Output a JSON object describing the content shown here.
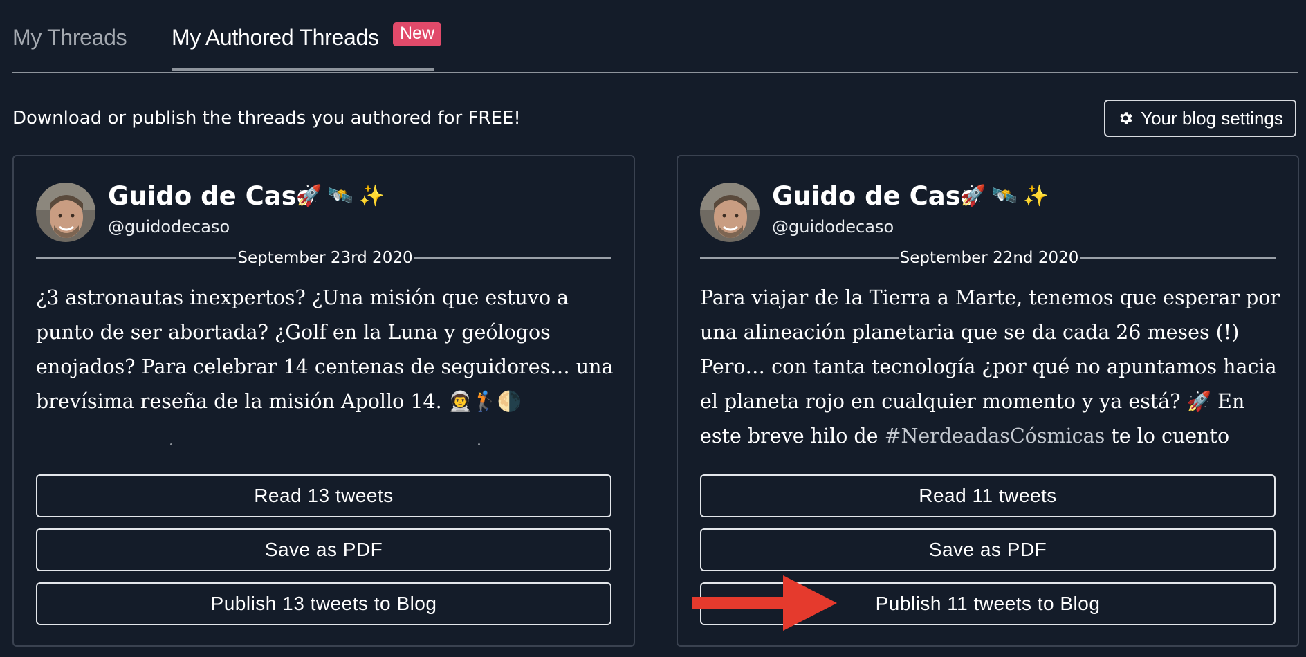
{
  "tabs": [
    {
      "label": "My Threads"
    },
    {
      "label": "My Authored Threads",
      "badge": "New"
    }
  ],
  "subtitle": "Download or publish the threads you authored for FREE!",
  "settings_button": {
    "label": "Your blog settings",
    "icon": "gear-icon"
  },
  "colors": {
    "background": "#141c29",
    "badge": "#e14a6a",
    "arrow": "#e53a2d",
    "border": "#3a4250"
  },
  "cards": [
    {
      "author": "Guido de Caso",
      "emojis": [
        "🚀",
        "🛰️",
        "✨"
      ],
      "handle": "@guidodecaso",
      "date": "September 23rd 2020",
      "text": "¿3 astronautas inexpertos? ¿Una misión que estuvo a punto de ser abortada? ¿Golf en la Luna y geólogos enojados? Para celebrar 14 centenas de seguidores… una brevísima reseña de la misión Apollo 14. 👨‍🚀🏌️🌗",
      "read_label": "Read 13 tweets",
      "pdf_label": "Save as PDF",
      "publish_label": "Publish 13 tweets to Blog"
    },
    {
      "author": "Guido de Caso",
      "emojis": [
        "🚀",
        "🛰️",
        "✨"
      ],
      "handle": "@guidodecaso",
      "date": "September 22nd 2020",
      "text_before": "Para viajar de la Tierra a Marte, tenemos que esperar por una alineación planetaria que se da cada 26 meses (!) Pero… con tanta tecnología ¿por qué no apuntamos hacia el planeta rojo en cualquier momento y ya está? 🚀  En este breve hilo de ",
      "hashtag": "#NerdeadasCósmicas",
      "text_after": " te lo cuento",
      "read_label": "Read 11 tweets",
      "pdf_label": "Save as PDF",
      "publish_label": "Publish 11 tweets to Blog"
    }
  ]
}
